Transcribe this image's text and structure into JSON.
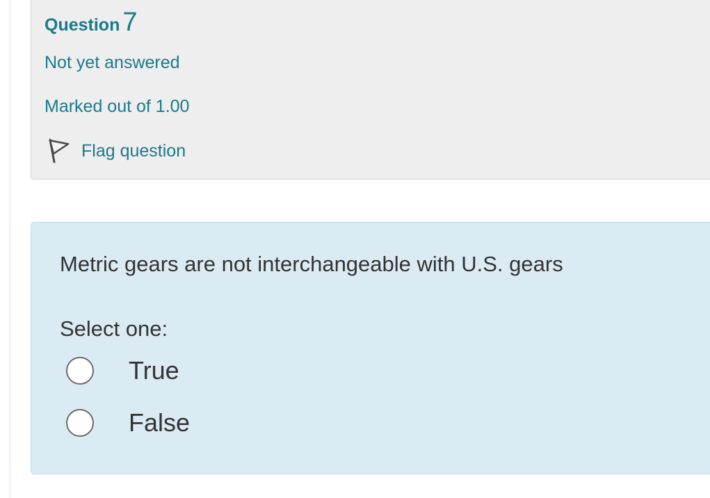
{
  "question_info": {
    "heading_word": "Question",
    "number": "7",
    "state": "Not yet answered",
    "grade": "Marked out of 1.00",
    "flag_label": "Flag question",
    "flag_icon": "flag-icon"
  },
  "question": {
    "text": "Metric gears are not interchangeable with U.S. gears",
    "prompt": "Select one:",
    "options": [
      {
        "label": "True",
        "selected": false
      },
      {
        "label": "False",
        "selected": false
      }
    ]
  },
  "colors": {
    "accent_text": "#1a7a8c",
    "info_background": "#eeeeee",
    "content_background": "#dbebf4",
    "body_text": "#333333"
  }
}
